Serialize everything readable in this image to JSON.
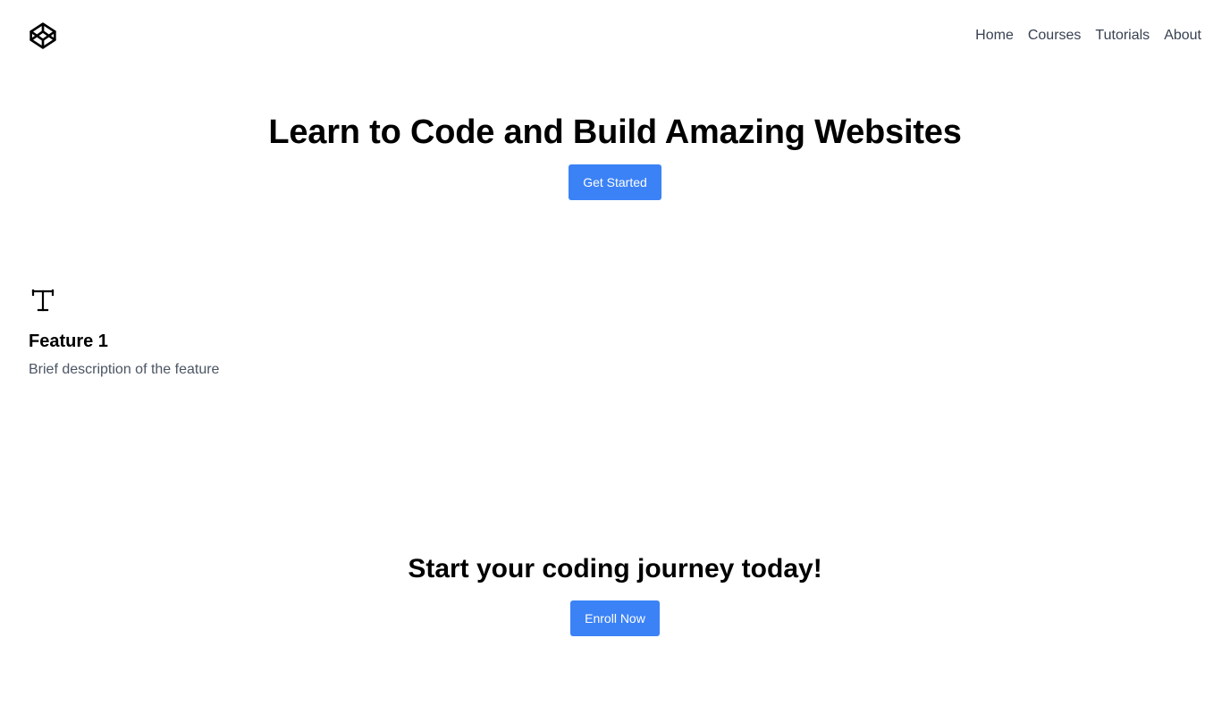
{
  "header": {
    "logo_icon": "codepen-cube-icon",
    "nav": {
      "home": "Home",
      "courses": "Courses",
      "tutorials": "Tutorials",
      "about": "About"
    }
  },
  "hero": {
    "title": "Learn to Code and Build Amazing Websites",
    "button_label": "Get Started"
  },
  "features": [
    {
      "icon": "text-t-icon",
      "title": "Feature 1",
      "description": "Brief description of the feature"
    }
  ],
  "cta": {
    "title": "Start your coding journey today!",
    "button_label": "Enroll Now"
  },
  "colors": {
    "accent": "#3b82f6",
    "nav_text": "#374151",
    "muted_text": "#4b5563",
    "heading": "#000000",
    "background": "#ffffff"
  }
}
